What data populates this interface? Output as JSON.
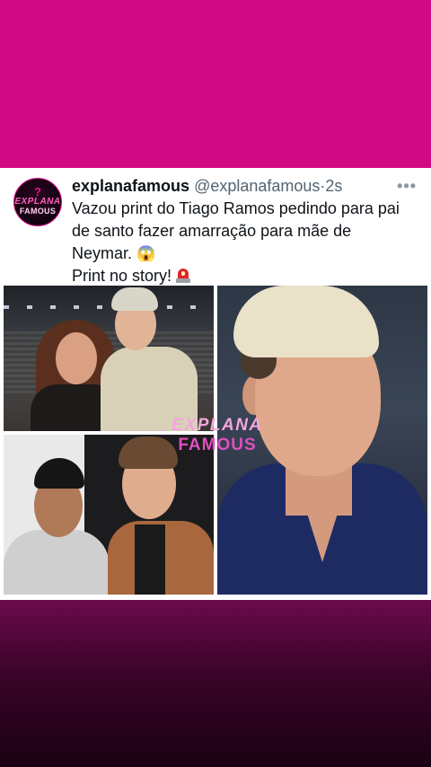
{
  "post": {
    "avatar": {
      "symbol": "?",
      "line1": "EXPLANA",
      "line2": "FAMOUS"
    },
    "display_name": "explanafamous",
    "handle": "@explanafamous",
    "separator": "·",
    "timestamp": "2s",
    "more_icon": "•••",
    "text_lines": [
      "Vazou print do Tiago Ramos pedindo para pai",
      "de santo fazer amarração para mãe de",
      "Neymar."
    ],
    "emoji_1": "😱",
    "text_line_4": "Print no story!",
    "emoji_2_icon": "siren-icon"
  },
  "watermark": {
    "line1": "EXPLANA",
    "line2": "FAMOUS"
  },
  "colors": {
    "background_top": "#d10a83",
    "brand_pink": "#e00a8f",
    "text": "#0f1419",
    "secondary_text": "#536471"
  }
}
